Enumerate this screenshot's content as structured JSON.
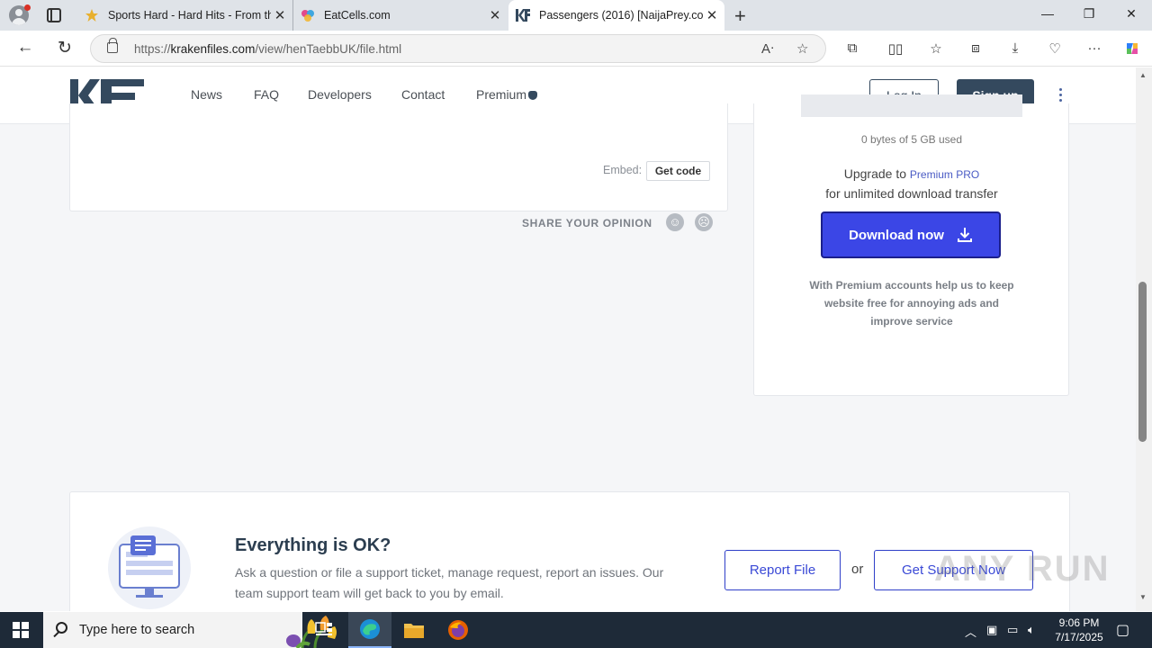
{
  "browser": {
    "tabs": [
      {
        "title": "Sports Hard - Hard Hits - From th",
        "favicon": "star-logo-icon"
      },
      {
        "title": "EatCells.com",
        "favicon": "colorful-logo-icon"
      },
      {
        "title": "Passengers (2016) [NaijaPrey.com",
        "favicon": "kf-logo-icon",
        "active": true
      }
    ],
    "url_prefix": "https://",
    "url_host": "krakenfiles.com",
    "url_path": "/view/henTaebbUK/file.html"
  },
  "site": {
    "nav": [
      "News",
      "FAQ",
      "Developers",
      "Contact",
      "Premium"
    ],
    "login_label": "Log In",
    "signup_label": "Sign up"
  },
  "file_card": {
    "embed_label": "Embed:",
    "get_code_label": "Get code",
    "share_opinion": "SHARE YOUR OPINION"
  },
  "download_panel": {
    "usage": "0 bytes of 5 GB used",
    "upgrade_prefix": "Upgrade to ",
    "premium_link": "Premium PRO",
    "upgrade_line2": "for unlimited download transfer",
    "download_label": "Download now",
    "note": "With Premium accounts help us to keep website free for annoying ads and improve service"
  },
  "support": {
    "title": "Everything is OK?",
    "text": "Ask a question or file a support ticket, manage request, report an issues. Our team support team will get back to you by email.",
    "report_label": "Report File",
    "or_label": "or",
    "support_label": "Get Support Now"
  },
  "watermark": "ANY RUN",
  "taskbar": {
    "search_placeholder": "Type here to search",
    "time": "9:06 PM",
    "date": "7/17/2025"
  },
  "colors": {
    "accent": "#3b46e6",
    "brand_dark": "#34495e",
    "taskbar": "#1e2a38"
  }
}
